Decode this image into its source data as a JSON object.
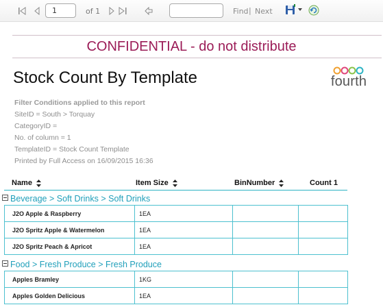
{
  "toolbar": {
    "page_value": "1",
    "of_label": "of 1",
    "find_label": "Find",
    "separator": "|",
    "next_label": "Next"
  },
  "banner": {
    "confidential": "CONFIDENTIAL - do not distribute"
  },
  "report": {
    "title": "Stock Count By Template",
    "logo_text": "fourth",
    "filters_heading": "Filter Conditions applied to this report",
    "filters": [
      "SiteID = South > Torquay",
      "CategoryID =",
      "No. of column = 1",
      "TemplateID = Stock Count Template",
      "Printed by Full Access on 16/09/2015 16:36"
    ]
  },
  "table": {
    "headers": [
      "Name",
      "Item Size",
      "BinNumber",
      "Count 1"
    ],
    "groups": [
      {
        "label": "Beverage > Soft Drinks > Soft Drinks",
        "rows": [
          {
            "name": "J2O Apple & Raspberry",
            "size": "1EA",
            "bin": "",
            "count": ""
          },
          {
            "name": "J2O Spritz Apple & Watermelon",
            "size": "1EA",
            "bin": "",
            "count": ""
          },
          {
            "name": "J2O Spritz Peach & Apricot",
            "size": "1EA",
            "bin": "",
            "count": ""
          }
        ]
      },
      {
        "label": "Food > Fresh Produce > Fresh Produce",
        "rows": [
          {
            "name": "Apples Bramley",
            "size": "1KG",
            "bin": "",
            "count": ""
          },
          {
            "name": "Apples Golden Delicious",
            "size": "1EA",
            "bin": "",
            "count": ""
          }
        ]
      }
    ]
  },
  "colors": {
    "confidential": "#9b1c57",
    "group_link": "#1f9fba",
    "grid_border": "#4cc0cf",
    "logo_ring_1": "#f0a030",
    "logo_ring_2": "#e0457a",
    "logo_ring_3": "#8bc34a",
    "logo_ring_4": "#2bb3c3"
  }
}
